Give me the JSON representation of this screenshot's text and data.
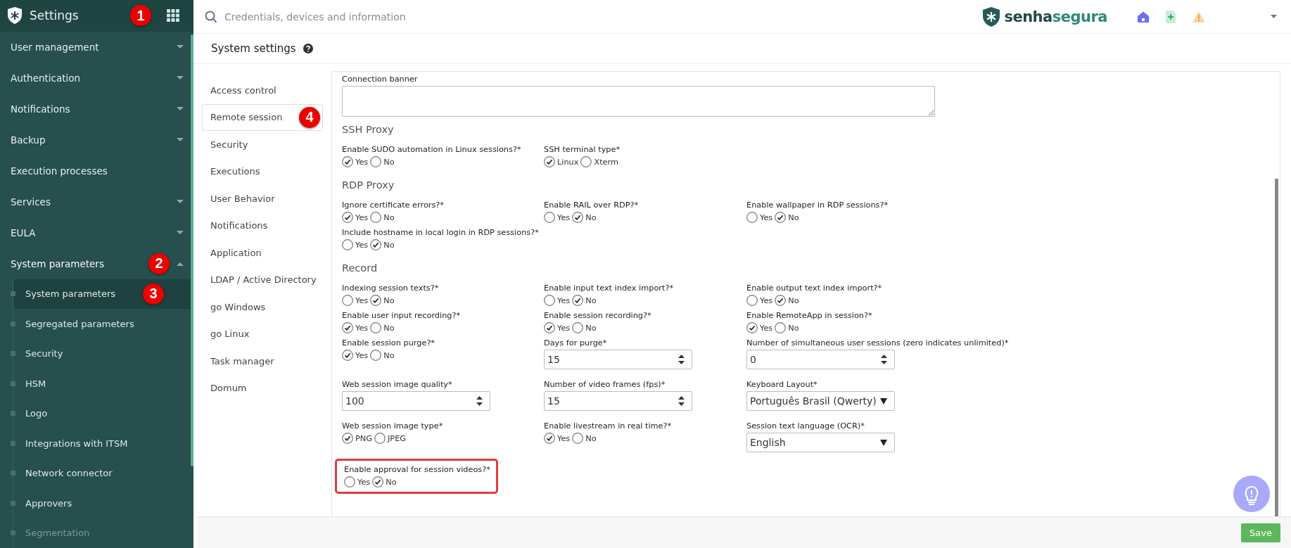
{
  "sidebar": {
    "title": "Settings",
    "badge": "1",
    "items": [
      {
        "label": "User management",
        "expanded": false
      },
      {
        "label": "Authentication",
        "expanded": false
      },
      {
        "label": "Notifications",
        "expanded": false
      },
      {
        "label": "Backup",
        "expanded": false
      },
      {
        "label": "Execution processes"
      },
      {
        "label": "Services",
        "expanded": false
      },
      {
        "label": "EULA",
        "expanded": false
      },
      {
        "label": "System parameters",
        "expanded": true,
        "badge": "2",
        "children": [
          {
            "label": "System parameters",
            "selected": true,
            "disabled": false,
            "badge": "3"
          },
          {
            "label": "Segregated parameters",
            "selected": false,
            "disabled": false
          },
          {
            "label": "Security",
            "selected": false,
            "disabled": false
          },
          {
            "label": "HSM",
            "selected": false,
            "disabled": false
          },
          {
            "label": "Logo",
            "selected": false,
            "disabled": false
          },
          {
            "label": "Integrations with ITSM",
            "selected": false,
            "disabled": false
          },
          {
            "label": "Network connector",
            "selected": false,
            "disabled": false
          },
          {
            "label": "Approvers",
            "selected": false,
            "disabled": false
          },
          {
            "label": "Segmentation",
            "selected": false,
            "disabled": true
          }
        ]
      }
    ]
  },
  "topbar": {
    "search": {
      "placeholder": "Credentials, devices and information"
    },
    "logo": {
      "part_1": "senha",
      "part_2": "segura"
    }
  },
  "page_title": "System settings",
  "settings_nav": [
    {
      "label": "Access control",
      "selected": false
    },
    {
      "label": "Remote session",
      "selected": true,
      "badge": "4"
    },
    {
      "label": "Security",
      "selected": false
    },
    {
      "label": "Executions",
      "selected": false
    },
    {
      "label": "User Behavior",
      "selected": false
    },
    {
      "label": "Notifications",
      "selected": false
    },
    {
      "label": "Application",
      "selected": false
    },
    {
      "label": "LDAP / Active Directory",
      "selected": false
    },
    {
      "label": "go Windows",
      "selected": false
    },
    {
      "label": "go Linux",
      "selected": false
    },
    {
      "label": "Task manager",
      "selected": false
    },
    {
      "label": "Domum",
      "selected": false
    }
  ],
  "form": [
    {
      "kind": "textarea",
      "label": "Connection banner"
    },
    {
      "kind": "heading",
      "text": "SSH Proxy"
    },
    {
      "kind": "row",
      "fields": [
        {
          "kind": "radio",
          "label": "Enable SUDO automation in Linux sessions?*",
          "highlighted": false,
          "options": [
            {
              "label": "Yes",
              "selected": true
            },
            {
              "label": "No",
              "selected": false
            }
          ]
        },
        {
          "kind": "radio",
          "label": "SSH terminal type*",
          "highlighted": false,
          "options": [
            {
              "label": "Linux",
              "selected": true
            },
            {
              "label": "Xterm",
              "selected": false
            }
          ]
        }
      ]
    },
    {
      "kind": "heading",
      "text": "RDP Proxy"
    },
    {
      "kind": "row",
      "fields": [
        {
          "kind": "radio",
          "label": "Ignore certificate errors?*",
          "highlighted": false,
          "options": [
            {
              "label": "Yes",
              "selected": true
            },
            {
              "label": "No",
              "selected": false
            }
          ]
        },
        {
          "kind": "radio",
          "label": "Enable RAIL over RDP?*",
          "highlighted": false,
          "options": [
            {
              "label": "Yes",
              "selected": false
            },
            {
              "label": "No",
              "selected": true
            }
          ]
        },
        {
          "kind": "radio",
          "label": "Enable wallpaper in RDP sessions?*",
          "highlighted": false,
          "options": [
            {
              "label": "Yes",
              "selected": false
            },
            {
              "label": "No",
              "selected": true
            }
          ]
        }
      ]
    },
    {
      "kind": "row",
      "fields": [
        {
          "kind": "radio",
          "label": "Include hostname in local login in RDP sessions?*",
          "highlighted": false,
          "options": [
            {
              "label": "Yes",
              "selected": false
            },
            {
              "label": "No",
              "selected": true
            }
          ]
        }
      ]
    },
    {
      "kind": "heading",
      "text": "Record"
    },
    {
      "kind": "row",
      "fields": [
        {
          "kind": "radio",
          "label": "Indexing session texts?*",
          "highlighted": false,
          "options": [
            {
              "label": "Yes",
              "selected": false
            },
            {
              "label": "No",
              "selected": true
            }
          ]
        },
        {
          "kind": "radio",
          "label": "Enable input text index import?*",
          "highlighted": false,
          "options": [
            {
              "label": "Yes",
              "selected": false
            },
            {
              "label": "No",
              "selected": true
            }
          ]
        },
        {
          "kind": "radio",
          "label": "Enable output text index import?*",
          "highlighted": false,
          "options": [
            {
              "label": "Yes",
              "selected": false
            },
            {
              "label": "No",
              "selected": true
            }
          ]
        }
      ]
    },
    {
      "kind": "row",
      "fields": [
        {
          "kind": "radio",
          "label": "Enable user input recording?*",
          "highlighted": false,
          "options": [
            {
              "label": "Yes",
              "selected": true
            },
            {
              "label": "No",
              "selected": false
            }
          ]
        },
        {
          "kind": "radio",
          "label": "Enable session recording?*",
          "highlighted": false,
          "options": [
            {
              "label": "Yes",
              "selected": true
            },
            {
              "label": "No",
              "selected": false
            }
          ]
        },
        {
          "kind": "radio",
          "label": "Enable RemoteApp in session?*",
          "highlighted": false,
          "options": [
            {
              "label": "Yes",
              "selected": true
            },
            {
              "label": "No",
              "selected": false
            }
          ]
        }
      ]
    },
    {
      "kind": "row",
      "fields": [
        {
          "kind": "radio",
          "label": "Enable session purge?*",
          "highlighted": false,
          "options": [
            {
              "label": "Yes",
              "selected": true
            },
            {
              "label": "No",
              "selected": false
            }
          ]
        },
        {
          "kind": "number",
          "label": "Days for purge*",
          "highlighted": false,
          "value": "15"
        },
        {
          "kind": "number",
          "label": "Number of simultaneous user sessions (zero indicates unlimited)*",
          "highlighted": false,
          "value": "0"
        }
      ]
    },
    {
      "kind": "row",
      "fields": [
        {
          "kind": "number",
          "label": "Web session image quality*",
          "highlighted": false,
          "value": "100"
        },
        {
          "kind": "number",
          "label": "Number of video frames (fps)*",
          "highlighted": false,
          "value": "15"
        },
        {
          "kind": "select",
          "label": "Keyboard Layout*",
          "highlighted": false,
          "value": "Português Brasil (Qwerty)"
        }
      ]
    },
    {
      "kind": "row",
      "fields": [
        {
          "kind": "radio",
          "label": "Web session image type*",
          "highlighted": false,
          "options": [
            {
              "label": "PNG",
              "selected": true
            },
            {
              "label": "JPEG",
              "selected": false
            }
          ]
        },
        {
          "kind": "radio",
          "label": "Enable livestream in real time?*",
          "highlighted": false,
          "options": [
            {
              "label": "Yes",
              "selected": true
            },
            {
              "label": "No",
              "selected": false
            }
          ]
        },
        {
          "kind": "select",
          "label": "Session text language (OCR)*",
          "highlighted": false,
          "value": "English"
        }
      ]
    },
    {
      "kind": "row",
      "fields": [
        {
          "kind": "radio",
          "label": "Enable approval for session videos?*",
          "highlighted": true,
          "options": [
            {
              "label": "Yes",
              "selected": false
            },
            {
              "label": "No",
              "selected": true
            }
          ]
        }
      ]
    }
  ],
  "footer": {
    "save_button": "Save"
  }
}
